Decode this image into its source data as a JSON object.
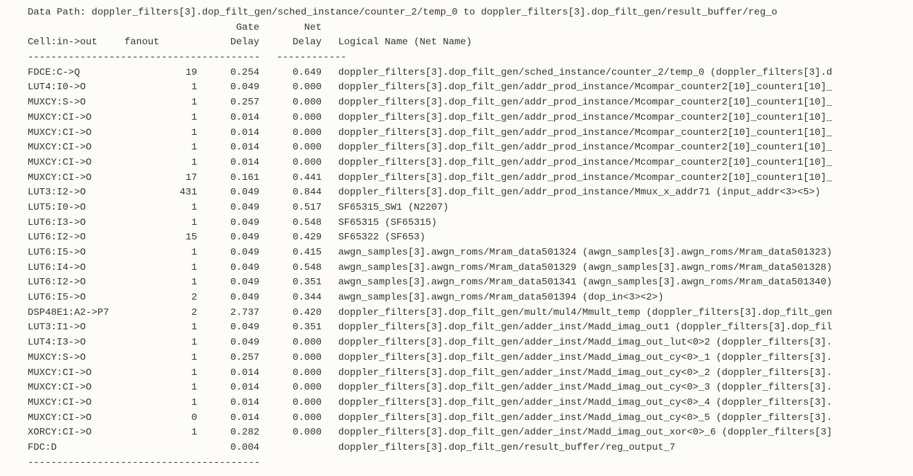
{
  "report": {
    "title_prefix": "Data Path: ",
    "title_path": "doppler_filters[3].dop_filt_gen/sched_instance/counter_2/temp_0 to doppler_filters[3].dop_filt_gen/result_buffer/reg_o",
    "header": {
      "line1": {
        "gate": "Gate",
        "net": "Net"
      },
      "line2": {
        "cell": "Cell:in->out",
        "fanout": "fanout",
        "gate": "Delay",
        "net": "Delay",
        "name": "Logical Name (Net Name)"
      }
    },
    "divider_cols": "----------------------------------------",
    "divider_name": "------------",
    "rows": [
      {
        "cell": "FDCE:C->Q",
        "fanout": "19",
        "gate": "0.254",
        "net": "0.649",
        "name": "doppler_filters[3].dop_filt_gen/sched_instance/counter_2/temp_0 (doppler_filters[3].d"
      },
      {
        "cell": "LUT4:I0->O",
        "fanout": "1",
        "gate": "0.049",
        "net": "0.000",
        "name": "doppler_filters[3].dop_filt_gen/addr_prod_instance/Mcompar_counter2[10]_counter1[10]_"
      },
      {
        "cell": "MUXCY:S->O",
        "fanout": "1",
        "gate": "0.257",
        "net": "0.000",
        "name": "doppler_filters[3].dop_filt_gen/addr_prod_instance/Mcompar_counter2[10]_counter1[10]_"
      },
      {
        "cell": "MUXCY:CI->O",
        "fanout": "1",
        "gate": "0.014",
        "net": "0.000",
        "name": "doppler_filters[3].dop_filt_gen/addr_prod_instance/Mcompar_counter2[10]_counter1[10]_"
      },
      {
        "cell": "MUXCY:CI->O",
        "fanout": "1",
        "gate": "0.014",
        "net": "0.000",
        "name": "doppler_filters[3].dop_filt_gen/addr_prod_instance/Mcompar_counter2[10]_counter1[10]_"
      },
      {
        "cell": "MUXCY:CI->O",
        "fanout": "1",
        "gate": "0.014",
        "net": "0.000",
        "name": "doppler_filters[3].dop_filt_gen/addr_prod_instance/Mcompar_counter2[10]_counter1[10]_"
      },
      {
        "cell": "MUXCY:CI->O",
        "fanout": "1",
        "gate": "0.014",
        "net": "0.000",
        "name": "doppler_filters[3].dop_filt_gen/addr_prod_instance/Mcompar_counter2[10]_counter1[10]_"
      },
      {
        "cell": "MUXCY:CI->O",
        "fanout": "17",
        "gate": "0.161",
        "net": "0.441",
        "name": "doppler_filters[3].dop_filt_gen/addr_prod_instance/Mcompar_counter2[10]_counter1[10]_"
      },
      {
        "cell": "LUT3:I2->O",
        "fanout": "431",
        "gate": "0.049",
        "net": "0.844",
        "name": "doppler_filters[3].dop_filt_gen/addr_prod_instance/Mmux_x_addr71 (input_addr<3><5>)"
      },
      {
        "cell": "LUT5:I0->O",
        "fanout": "1",
        "gate": "0.049",
        "net": "0.517",
        "name": "SF65315_SW1 (N2207)"
      },
      {
        "cell": "LUT6:I3->O",
        "fanout": "1",
        "gate": "0.049",
        "net": "0.548",
        "name": "SF65315 (SF65315)"
      },
      {
        "cell": "LUT6:I2->O",
        "fanout": "15",
        "gate": "0.049",
        "net": "0.429",
        "name": "SF65322 (SF653)"
      },
      {
        "cell": "LUT6:I5->O",
        "fanout": "1",
        "gate": "0.049",
        "net": "0.415",
        "name": "awgn_samples[3].awgn_roms/Mram_data501324 (awgn_samples[3].awgn_roms/Mram_data501323)"
      },
      {
        "cell": "LUT6:I4->O",
        "fanout": "1",
        "gate": "0.049",
        "net": "0.548",
        "name": "awgn_samples[3].awgn_roms/Mram_data501329 (awgn_samples[3].awgn_roms/Mram_data501328)"
      },
      {
        "cell": "LUT6:I2->O",
        "fanout": "1",
        "gate": "0.049",
        "net": "0.351",
        "name": "awgn_samples[3].awgn_roms/Mram_data501341 (awgn_samples[3].awgn_roms/Mram_data501340)"
      },
      {
        "cell": "LUT6:I5->O",
        "fanout": "2",
        "gate": "0.049",
        "net": "0.344",
        "name": "awgn_samples[3].awgn_roms/Mram_data501394 (dop_in<3><2>)"
      },
      {
        "cell": "DSP48E1:A2->P7",
        "fanout": "2",
        "gate": "2.737",
        "net": "0.420",
        "name": "doppler_filters[3].dop_filt_gen/mult/mul4/Mmult_temp (doppler_filters[3].dop_filt_gen"
      },
      {
        "cell": "LUT3:I1->O",
        "fanout": "1",
        "gate": "0.049",
        "net": "0.351",
        "name": "doppler_filters[3].dop_filt_gen/adder_inst/Madd_imag_out1 (doppler_filters[3].dop_fil"
      },
      {
        "cell": "LUT4:I3->O",
        "fanout": "1",
        "gate": "0.049",
        "net": "0.000",
        "name": "doppler_filters[3].dop_filt_gen/adder_inst/Madd_imag_out_lut<0>2 (doppler_filters[3]."
      },
      {
        "cell": "MUXCY:S->O",
        "fanout": "1",
        "gate": "0.257",
        "net": "0.000",
        "name": "doppler_filters[3].dop_filt_gen/adder_inst/Madd_imag_out_cy<0>_1 (doppler_filters[3]."
      },
      {
        "cell": "MUXCY:CI->O",
        "fanout": "1",
        "gate": "0.014",
        "net": "0.000",
        "name": "doppler_filters[3].dop_filt_gen/adder_inst/Madd_imag_out_cy<0>_2 (doppler_filters[3]."
      },
      {
        "cell": "MUXCY:CI->O",
        "fanout": "1",
        "gate": "0.014",
        "net": "0.000",
        "name": "doppler_filters[3].dop_filt_gen/adder_inst/Madd_imag_out_cy<0>_3 (doppler_filters[3]."
      },
      {
        "cell": "MUXCY:CI->O",
        "fanout": "1",
        "gate": "0.014",
        "net": "0.000",
        "name": "doppler_filters[3].dop_filt_gen/adder_inst/Madd_imag_out_cy<0>_4 (doppler_filters[3]."
      },
      {
        "cell": "MUXCY:CI->O",
        "fanout": "0",
        "gate": "0.014",
        "net": "0.000",
        "name": "doppler_filters[3].dop_filt_gen/adder_inst/Madd_imag_out_cy<0>_5 (doppler_filters[3]."
      },
      {
        "cell": "XORCY:CI->O",
        "fanout": "1",
        "gate": "0.282",
        "net": "0.000",
        "name": "doppler_filters[3].dop_filt_gen/adder_inst/Madd_imag_out_xor<0>_6 (doppler_filters[3]"
      },
      {
        "cell": "FDC:D",
        "fanout": "",
        "gate": "0.004",
        "net": "",
        "name": "doppler_filters[3].dop_filt_gen/result_buffer/reg_output_7"
      }
    ]
  }
}
